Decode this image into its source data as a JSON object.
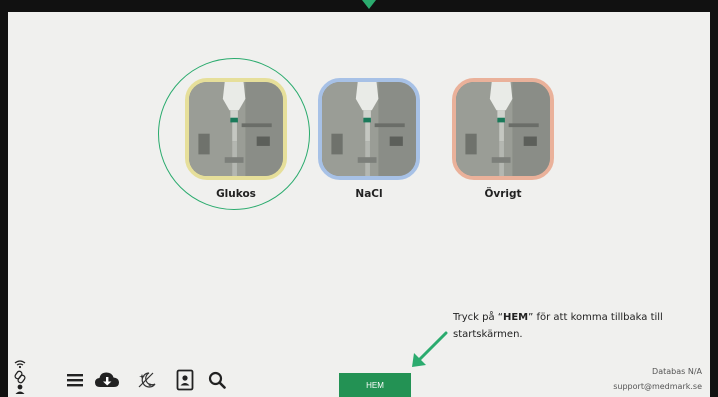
{
  "categories": [
    {
      "label": "Glukos",
      "accent": "#e6df9a"
    },
    {
      "label": "NaCl",
      "accent": "#a7c1e6"
    },
    {
      "label": "Övrigt",
      "accent": "#eab19a"
    }
  ],
  "hint": {
    "prefix": "Tryck på “",
    "keyword": "HEM",
    "suffix": "” för att komma tillbaka till startskärmen."
  },
  "home_button": {
    "label": "HEM",
    "color": "#239254"
  },
  "footer": {
    "database": "Databas N/A",
    "support": "support@medmark.se"
  },
  "toolbar_icons": [
    "wifi-icon",
    "link-icon",
    "person-icon",
    "menu-icon",
    "cloud-download-icon",
    "night-mode-icon",
    "id-badge-icon",
    "search-icon"
  ],
  "colors": {
    "highlight": "#2bab6e",
    "frame": "#111111",
    "background": "#f0f0ee"
  }
}
